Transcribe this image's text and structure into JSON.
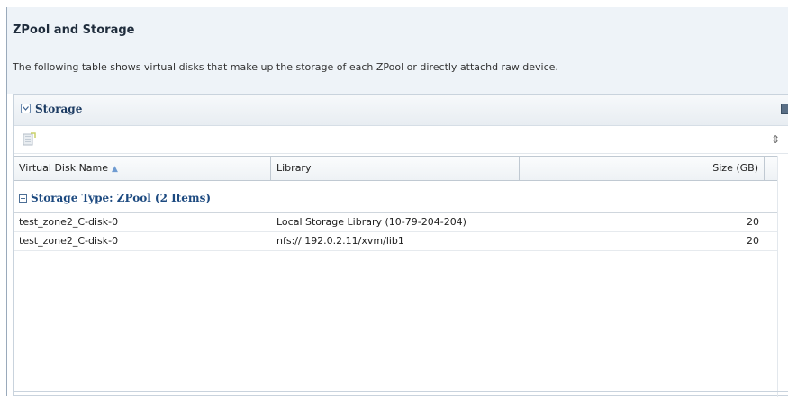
{
  "section": {
    "title": "ZPool and Storage",
    "description": "The following table shows virtual disks that make up the storage of each ZPool or directly attachd raw device."
  },
  "panel": {
    "title": "Storage",
    "collapse_icon": "chevron-down-icon",
    "menu_icon": "panel-menu-icon"
  },
  "toolbar": {
    "export_icon": "export-icon",
    "refresh_icon": "refresh-icon"
  },
  "table": {
    "columns": [
      {
        "label": "Virtual Disk Name",
        "sorted": "ascending"
      },
      {
        "label": "Library"
      },
      {
        "label": "Size (GB)"
      }
    ],
    "group": {
      "label": "Storage Type: ZPool (2 Items)"
    },
    "rows": [
      {
        "name": "test_zone2_C-disk-0",
        "library": "Local Storage Library (10-79-204-204)",
        "size": "20"
      },
      {
        "name": "test_zone2_C-disk-0",
        "library": "nfs:// 192.0.2.11/xvm/lib1",
        "size": "20"
      }
    ]
  }
}
